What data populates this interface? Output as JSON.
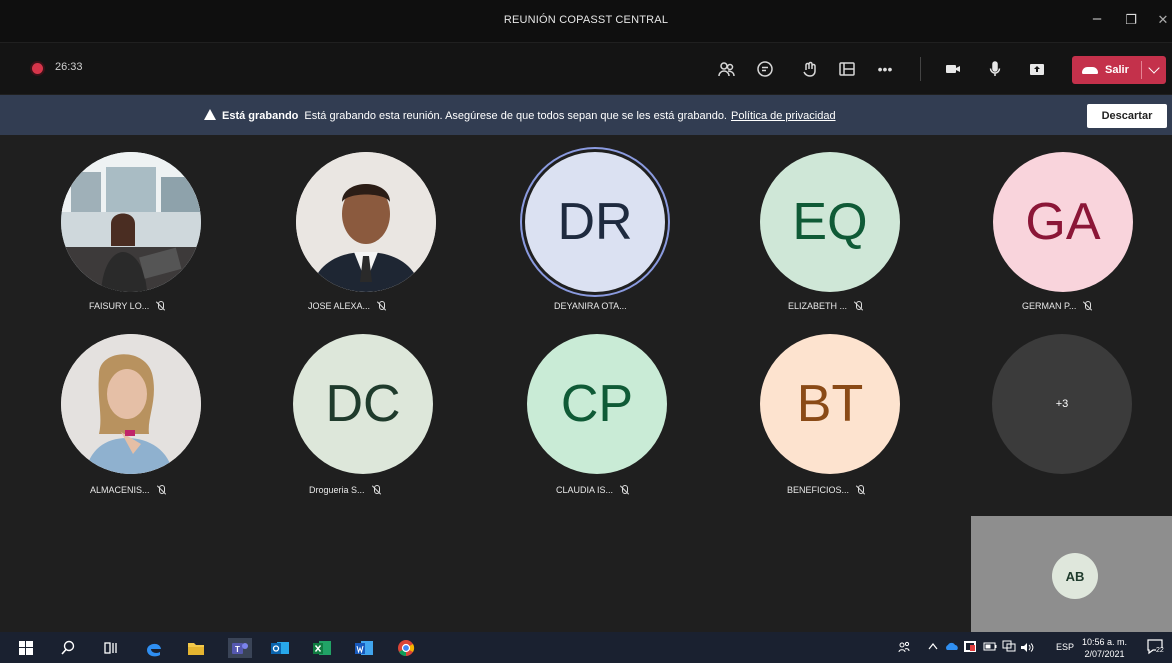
{
  "window": {
    "title": "REUNIÓN COPASST CENTRAL"
  },
  "toolbar": {
    "timer": "26:33",
    "leave_label": "Salir"
  },
  "banner": {
    "bold": "Está grabando",
    "message": "Está grabando esta reunión. Asegúrese de que todos sepan que se les está grabando.",
    "link": "Política de privacidad",
    "dismiss": "Descartar"
  },
  "participants": [
    {
      "initials": "",
      "name": "FAISURY LO...",
      "photo": "woman-office"
    },
    {
      "initials": "",
      "name": "JOSE ALEXA...",
      "photo": "man-suit"
    },
    {
      "initials": "DR",
      "name": "DEYANIRA OTA...",
      "bg": "#dbe1f2",
      "fg": "#1e2a3f",
      "active": true
    },
    {
      "initials": "EQ",
      "name": "ELIZABETH ...",
      "bg": "#cfe7d7",
      "fg": "#0f5a36"
    },
    {
      "initials": "GA",
      "name": "GERMAN P...",
      "bg": "#f9d4dc",
      "fg": "#8b1637"
    },
    {
      "initials": "",
      "name": "ALMACENIS...",
      "photo": "woman-smile"
    },
    {
      "initials": "DC",
      "name": "Drogueria S...",
      "bg": "#dde7da",
      "fg": "#1f3b2c"
    },
    {
      "initials": "CP",
      "name": "CLAUDIA IS...",
      "bg": "#c9ebd6",
      "fg": "#0f5a36"
    },
    {
      "initials": "BT",
      "name": "BENEFICIOS...",
      "bg": "#fde3cf",
      "fg": "#8a4a16"
    },
    {
      "initials": "+3",
      "name": "",
      "bg": "#3b3b3b",
      "fg": "#ffffff"
    }
  ],
  "self_view": {
    "initials": "AB"
  },
  "taskbar": {
    "time": "10:56 a. m.",
    "date": "2/07/2021",
    "lang": "ESP",
    "notification_count": "22"
  }
}
